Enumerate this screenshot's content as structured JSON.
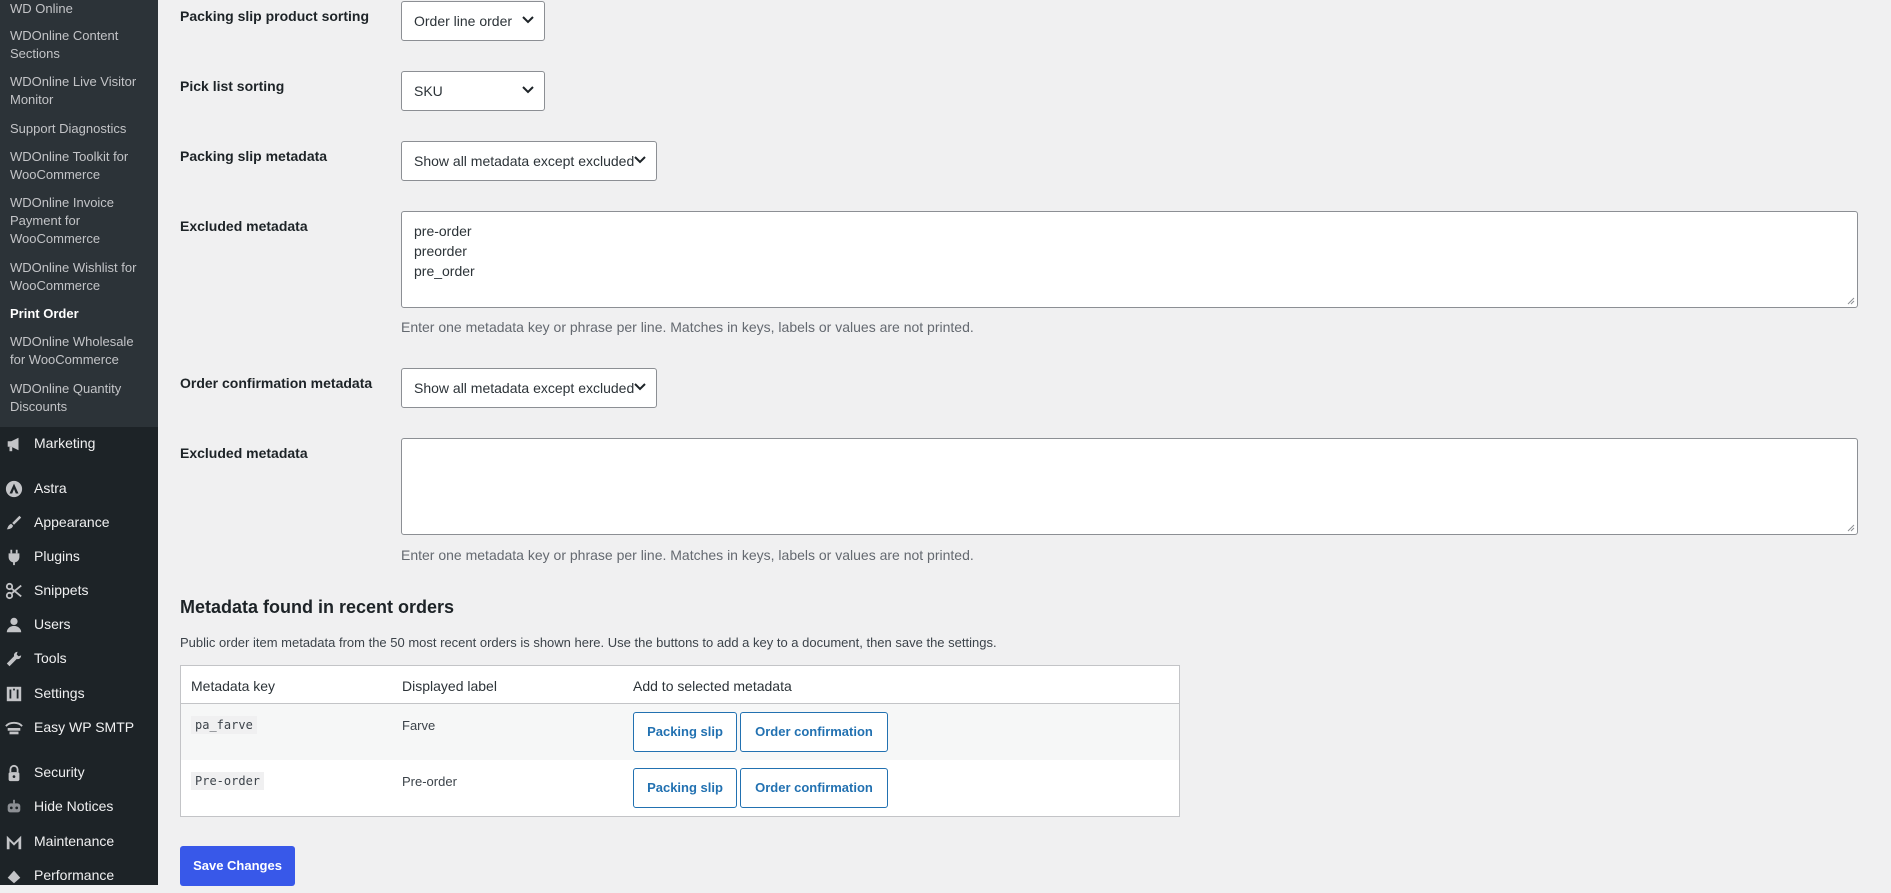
{
  "sidebar": {
    "submenu": [
      {
        "label": "WD Online",
        "lines": [
          "WD Online"
        ]
      },
      {
        "label": "WDOnline Content Sections",
        "lines": [
          "WDOnline Content",
          "Sections"
        ]
      },
      {
        "label": "WDOnline Live Visitor Monitor",
        "lines": [
          "WDOnline Live Visitor",
          "Monitor"
        ]
      },
      {
        "label": "Support Diagnostics",
        "lines": [
          "Support Diagnostics"
        ]
      },
      {
        "label": "WDOnline Toolkit for WooCommerce",
        "lines": [
          "WDOnline Toolkit for",
          "WooCommerce"
        ]
      },
      {
        "label": "WDOnline Invoice Payment for WooCommerce",
        "lines": [
          "WDOnline Invoice",
          "Payment for",
          "WooCommerce"
        ]
      },
      {
        "label": "WDOnline Wishlist for WooCommerce",
        "lines": [
          "WDOnline Wishlist for",
          "WooCommerce"
        ]
      },
      {
        "label": "Print Order",
        "lines": [
          "Print Order"
        ],
        "current": true
      },
      {
        "label": "WDOnline Wholesale for WooCommerce",
        "lines": [
          "WDOnline Wholesale",
          "for WooCommerce"
        ]
      },
      {
        "label": "WDOnline Quantity Discounts",
        "lines": [
          "WDOnline Quantity",
          "Discounts"
        ]
      }
    ],
    "menu": [
      {
        "label": "Marketing",
        "icon": "megaphone-icon"
      },
      {
        "label": "Astra",
        "icon": "astra-icon"
      },
      {
        "label": "Appearance",
        "icon": "paintbrush-icon"
      },
      {
        "label": "Plugins",
        "icon": "plug-icon"
      },
      {
        "label": "Snippets",
        "icon": "scissors-icon"
      },
      {
        "label": "Users",
        "icon": "user-icon"
      },
      {
        "label": "Tools",
        "icon": "wrench-icon"
      },
      {
        "label": "Settings",
        "icon": "settings-icon"
      },
      {
        "label": "Easy WP SMTP",
        "icon": "smtp-icon"
      },
      {
        "label": "Security",
        "icon": "lock-icon"
      },
      {
        "label": "Hide Notices",
        "icon": "robot-icon"
      },
      {
        "label": "Maintenance",
        "icon": "maintenance-icon"
      },
      {
        "label": "Performance",
        "icon": "performance-icon"
      }
    ]
  },
  "form": {
    "packing_sort": {
      "label": "Packing slip product sorting",
      "value": "Order line order"
    },
    "pick_sort": {
      "label": "Pick list sorting",
      "value": "SKU"
    },
    "packing_meta": {
      "label": "Packing slip metadata",
      "value": "Show all metadata except excluded"
    },
    "excluded1": {
      "label": "Excluded metadata",
      "lines": [
        "pre-order",
        "preorder",
        "pre_order"
      ],
      "help": "Enter one metadata key or phrase per line. Matches in keys, labels or values are not printed."
    },
    "confirm_meta": {
      "label": "Order confirmation metadata",
      "value": "Show all metadata except excluded"
    },
    "excluded2": {
      "label": "Excluded metadata",
      "lines": [],
      "help": "Enter one metadata key or phrase per line. Matches in keys, labels or values are not printed."
    }
  },
  "metadata_section": {
    "heading": "Metadata found in recent orders",
    "description": "Public order item metadata from the 50 most recent orders is shown here. Use the buttons to add a key to a document, then save the settings.",
    "columns": [
      "Metadata key",
      "Displayed label",
      "Add to selected metadata"
    ],
    "rows": [
      {
        "key": "pa_farve",
        "label": "Farve",
        "btn_packing": "Packing slip",
        "btn_confirm": "Order confirmation"
      },
      {
        "key": "Pre-order",
        "label": "Pre-order",
        "btn_packing": "Packing slip",
        "btn_confirm": "Order confirmation"
      }
    ]
  },
  "save_label": "Save Changes",
  "colors": {
    "sidebar_bg": "#1d2327",
    "submenu_bg": "#2c3338",
    "page_bg": "#f0f0f1",
    "link_blue": "#2271b1",
    "save_blue": "#3858e9"
  }
}
